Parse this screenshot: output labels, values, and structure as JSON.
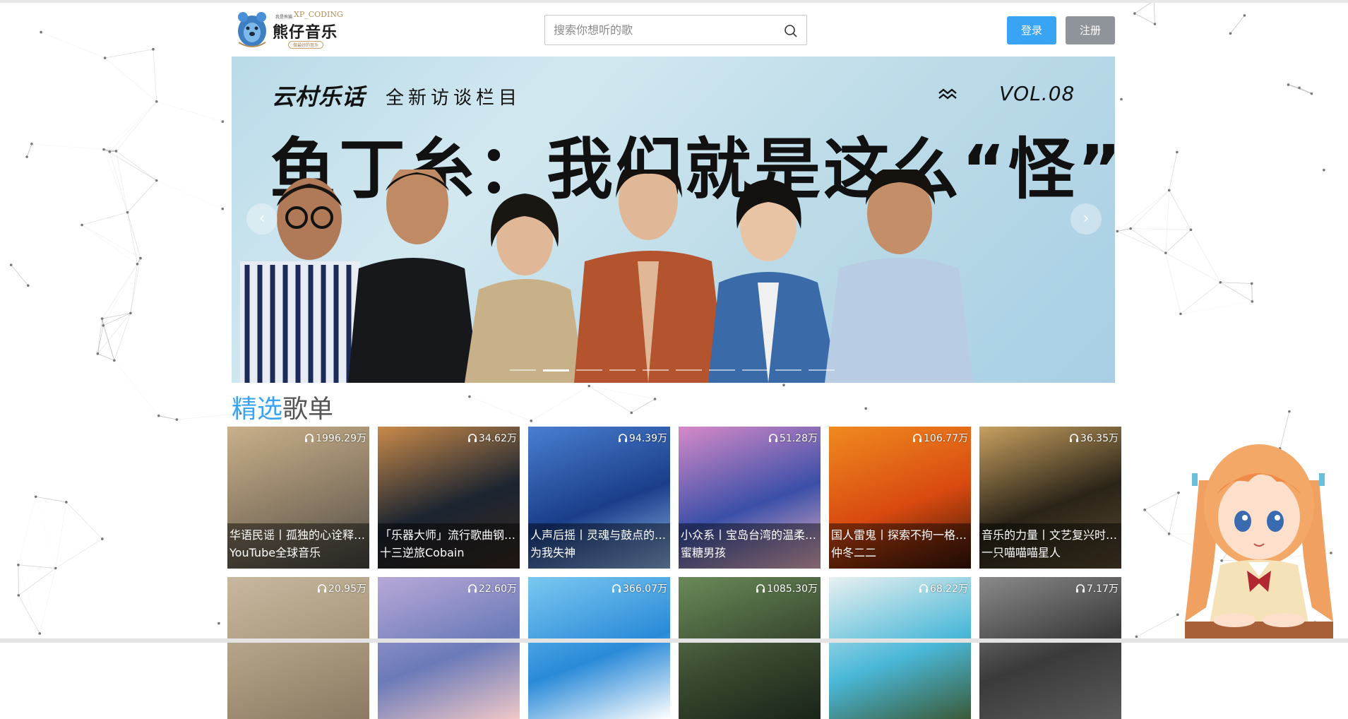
{
  "header": {
    "logo_small": "我是熊猫",
    "logo_brand": "XP_CODING",
    "logo_name": "熊仔音乐",
    "logo_tag": "做最好的音乐",
    "search_placeholder": "搜索你想听的歌",
    "login_label": "登录",
    "register_label": "注册"
  },
  "banner": {
    "tagline_a": "云村乐话",
    "tagline_b": "全新访谈栏目",
    "vol": "VOL.08",
    "headline": "鱼丁糸：我们就是这么“怪”！",
    "prev_label": "‹",
    "next_label": "›",
    "slide_count": 10,
    "active_slide": 2
  },
  "section": {
    "title_accent": "精选",
    "title_rest": "歌单"
  },
  "playlists": [
    {
      "plays": "1996.29万",
      "title": "华语民谣丨孤独的心诠释青春的苦",
      "author": "YouTube全球音乐",
      "colors": [
        "#8a7a64",
        "#c9b08a",
        "#4c4a44"
      ]
    },
    {
      "plays": "34.62万",
      "title": "「乐器大师」流行歌曲钢琴曲合集",
      "author": "十三逆旅Cobain",
      "colors": [
        "#1b2430",
        "#c98a4a",
        "#3a2a20"
      ]
    },
    {
      "plays": "94.39万",
      "title": "人声后摇丨灵魂与鼓点的碰撞",
      "author": "为我失神",
      "colors": [
        "#1a3e8a",
        "#4a7ed0",
        "#8fb7e8"
      ]
    },
    {
      "plays": "51.28万",
      "title": "小众系丨宝岛台湾的温柔独立",
      "author": "蜜糖男孩",
      "colors": [
        "#3a4fa8",
        "#d68ac8",
        "#f0b8c8"
      ]
    },
    {
      "plays": "106.77万",
      "title": "国人雷鬼丨探索不拘一格的律动",
      "author": "仲冬二二",
      "colors": [
        "#d84a10",
        "#f08a20",
        "#3a1408"
      ]
    },
    {
      "plays": "36.35万",
      "title": "音乐的力量丨文艺复兴时期的回响",
      "author": "一只喵喵喵星人",
      "colors": [
        "#2a2418",
        "#c8a060",
        "#5a4a30"
      ]
    },
    {
      "plays": "20.95万",
      "title": "",
      "author": "",
      "colors": [
        "#a8987c",
        "#c8b8a0",
        "#8a7a64"
      ]
    },
    {
      "plays": "22.60万",
      "title": "",
      "author": "",
      "colors": [
        "#6a7ab8",
        "#b8a8d8",
        "#f0c8c8"
      ]
    },
    {
      "plays": "366.07万",
      "title": "",
      "author": "",
      "colors": [
        "#2a8ad8",
        "#7ac8f0",
        "#ffffff"
      ]
    },
    {
      "plays": "1085.30万",
      "title": "",
      "author": "",
      "colors": [
        "#3a4a30",
        "#6a8a58",
        "#1a2418"
      ]
    },
    {
      "plays": "68.22万",
      "title": "",
      "author": "",
      "colors": [
        "#4ab8d8",
        "#e8f0f0",
        "#3a5a38"
      ]
    },
    {
      "plays": "7.17万",
      "title": "",
      "author": "",
      "colors": [
        "#3a3a3a",
        "#8a8a8a",
        "#5a5a5a"
      ]
    }
  ]
}
